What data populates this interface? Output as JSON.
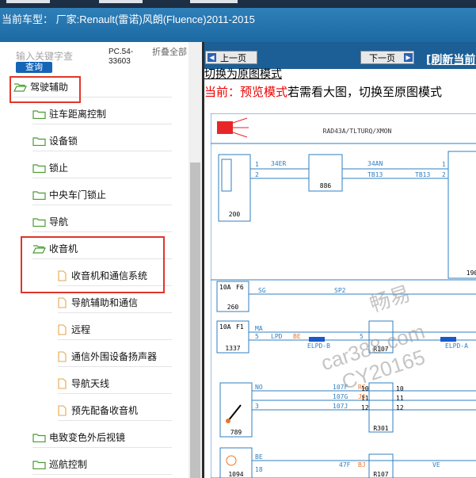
{
  "header": {
    "vehicle_text": "当前车型： 厂家:Renault(雷诺)风朗(Fluence)2011-2015"
  },
  "sidebar": {
    "search_placeholder": "输入关键字查",
    "query_label": "查询",
    "code": "PC.54-33603",
    "collapse_all_label": "折叠全部",
    "items": [
      {
        "label": "驾驶辅助",
        "type": "folder",
        "level": 0,
        "open": true,
        "highlighted": true
      },
      {
        "label": "驻车距离控制",
        "type": "folder",
        "level": 1
      },
      {
        "label": "设备锁",
        "type": "folder",
        "level": 1
      },
      {
        "label": "锁止",
        "type": "folder",
        "level": 1
      },
      {
        "label": "中央车门锁止",
        "type": "folder",
        "level": 1
      },
      {
        "label": "导航",
        "type": "folder",
        "level": 1
      },
      {
        "label": "收音机",
        "type": "folder",
        "level": 1,
        "open": true,
        "highlighted": true
      },
      {
        "label": "收音机和通信系统",
        "type": "page",
        "level": 2,
        "highlighted": true
      },
      {
        "label": "导航辅助和通信",
        "type": "page",
        "level": 2
      },
      {
        "label": "远程",
        "type": "page",
        "level": 2
      },
      {
        "label": "通信外围设备扬声器",
        "type": "page",
        "level": 2
      },
      {
        "label": "导航天线",
        "type": "page",
        "level": 2
      },
      {
        "label": "预先配备收音机",
        "type": "page",
        "level": 2
      },
      {
        "label": "电致变色外后视镜",
        "type": "folder",
        "level": 1
      },
      {
        "label": "巡航控制",
        "type": "folder",
        "level": 1
      }
    ]
  },
  "viewer": {
    "prev_label": "上一页",
    "next_label": "下一页",
    "refresh_label": "[刷新当前",
    "switch_link": "切换为原图模式",
    "mode_label": "当前：",
    "mode_value": "预览模式",
    "mode_hint": "若需看大图，切换至原图模式"
  },
  "diagram": {
    "title": "RAD43A/TLTURQ/XMON",
    "components": [
      "200",
      "886",
      "190",
      "260",
      "1337",
      "789",
      "1094"
    ],
    "relays": [
      "R107",
      "R301",
      "R107"
    ],
    "fuses": [
      {
        "rating": "10A",
        "id": "F6"
      },
      {
        "rating": "10A",
        "id": "F1"
      }
    ],
    "wire_labels": [
      "34ER",
      "34AN",
      "TB13",
      "TB13",
      "SG",
      "SP2",
      "MA",
      "LPD",
      "BE",
      "ELPD-B",
      "ELPD-A",
      "NO",
      "107F",
      "107G",
      "107J",
      "RG",
      "JA",
      "BE",
      "47F",
      "VE",
      "BJ",
      "18"
    ],
    "pins": [
      "1",
      "2",
      "1",
      "2",
      "3",
      "5",
      "5",
      "10",
      "11",
      "12",
      "10",
      "11",
      "12"
    ]
  },
  "watermark": [
    "畅易",
    "car388.com",
    "CY20165"
  ],
  "colors": {
    "header": "#1f6fab",
    "nav_bar": "#1c5f96",
    "highlight_box": "#e0362a",
    "query_button": "#1565b6",
    "mode_text": "#e00000",
    "diagram_lines": "#2f7fc0"
  }
}
